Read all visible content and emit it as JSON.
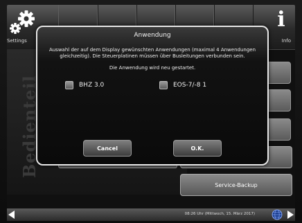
{
  "topbar": {
    "settings_label": "Settings",
    "info_label": "Info"
  },
  "background": {
    "panel_label": "Bedienteil",
    "service_backup_label": "Service-Backup"
  },
  "dialog": {
    "title": "Anwendung",
    "description": "Auswahl der auf dem Display gewünschten Anwendungen (maximal 4 Anwendungen gleichzeitig). Die Steuerplatinen müssen über Busleitungen verbunden sein.",
    "restart_note": "Die Anwendung wird neu gestartet.",
    "options": [
      {
        "label": "BHZ 3.0",
        "checked": false
      },
      {
        "label": "EOS-7/-8 1",
        "checked": false
      }
    ],
    "cancel_label": "Cancel",
    "ok_label": "O.K."
  },
  "statusbar": {
    "datetime": "08:26 Uhr (Mittwoch, 15. März 2017)"
  },
  "icons": {
    "settings": "gear-icon",
    "info": "info-icon",
    "nav_left": "arrow-left-icon",
    "nav_right": "arrow-right-icon",
    "globe": "globe-icon"
  }
}
